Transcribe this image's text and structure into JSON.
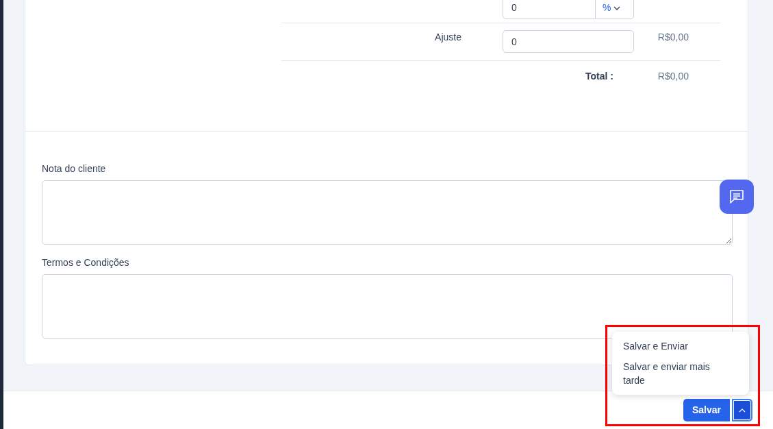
{
  "totals": {
    "rows": [
      {
        "kind": "discount",
        "value": "0",
        "unit": "%"
      },
      {
        "kind": "adjust",
        "label": "Ajuste",
        "value": "0",
        "amount": "R$0,00"
      },
      {
        "kind": "total",
        "label": "Total :",
        "amount": "R$0,00"
      }
    ]
  },
  "fields": [
    {
      "label": "Nota do cliente"
    },
    {
      "label": "Termos e Condições"
    }
  ],
  "footer": {
    "save_button": "Salvar",
    "menu": {
      "expanded": true,
      "items": [
        "Salvar e Enviar",
        "Salvar e enviar mais tarde"
      ]
    }
  }
}
